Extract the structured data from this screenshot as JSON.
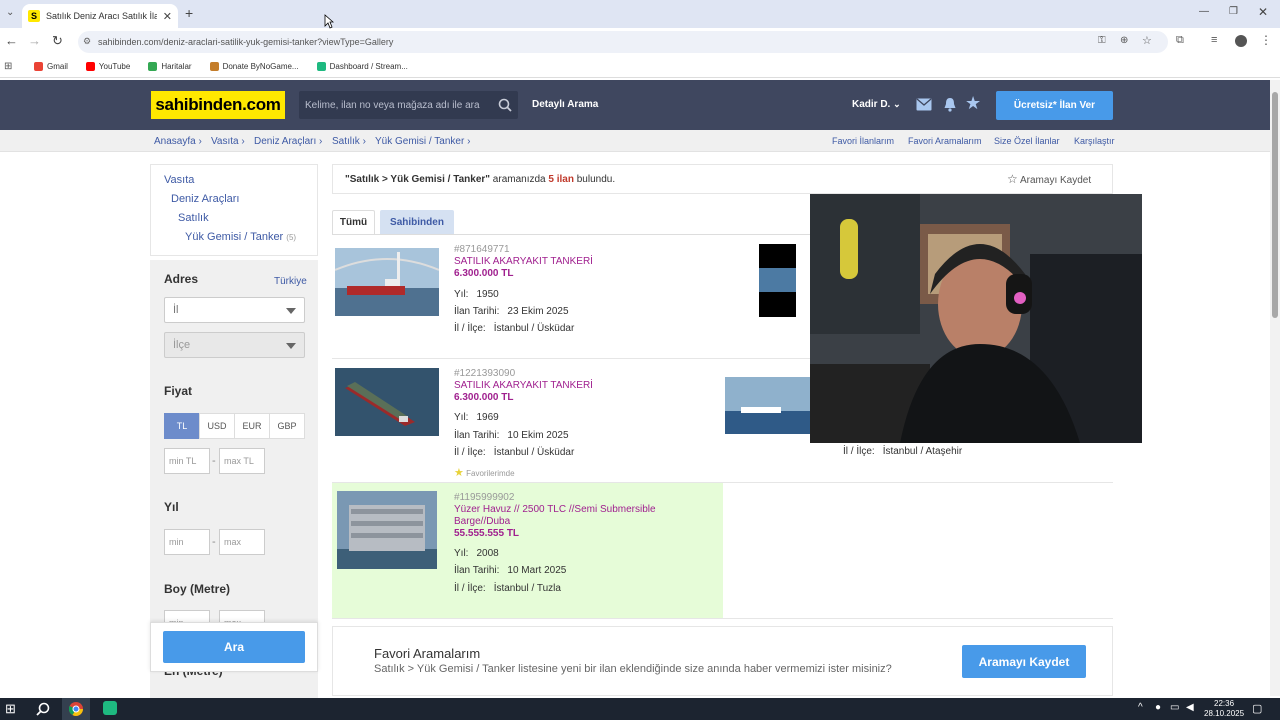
{
  "browser": {
    "tab_title": "Satılık Deniz Aracı Satılık İlanları",
    "tab_favicon": "S",
    "url": "sahibinden.com/deniz-araclari-satilik-yuk-gemisi-tanker?viewType=Gallery",
    "bookmarks": [
      {
        "label": "Gmail",
        "color": "#ea4335"
      },
      {
        "label": "YouTube",
        "color": "#ff0000"
      },
      {
        "label": "Haritalar",
        "color": "#34a853"
      },
      {
        "label": "Donate ByNoGame...",
        "color": "#c47d2a"
      },
      {
        "label": "Dashboard / Stream...",
        "color": "#1eb980"
      }
    ]
  },
  "header": {
    "logo": "sahibinden.com",
    "search_placeholder": "Kelime, ilan no veya mağaza adı ile ara",
    "detailed_search": "Detaylı Arama",
    "user_name": "Kadir D.",
    "post_ad_button": "Ücretsiz* İlan Ver"
  },
  "breadcrumb": [
    "Anasayfa",
    "Vasıta",
    "Deniz Araçları",
    "Satılık",
    "Yük Gemisi / Tanker"
  ],
  "top_links": [
    "Favori İlanlarım",
    "Favori Aramalarım",
    "Size Özel İlanlar",
    "Karşılaştır"
  ],
  "sidebar": {
    "categories": [
      "Vasıta",
      "Deniz Araçları",
      "Satılık",
      "Yük Gemisi / Tanker"
    ],
    "category_count": "(5)",
    "address_label": "Adres",
    "country_link": "Türkiye",
    "il_placeholder": "İl",
    "ilce_placeholder": "İlçe",
    "price_label": "Fiyat",
    "currencies": [
      "TL",
      "USD",
      "EUR",
      "GBP"
    ],
    "active_currency": "TL",
    "min_tl": "min TL",
    "max_tl": "max TL",
    "year_label": "Yıl",
    "min": "min",
    "max": "max",
    "length_label": "Boy (Metre)",
    "width_label": "En (Metre)",
    "search_button": "Ara"
  },
  "results": {
    "query": "\"Satılık > Yük Gemisi / Tanker\"",
    "query_suffix": "aramanızda",
    "count": "5 ilan",
    "found": "bulundu.",
    "save_search": "Aramayı Kaydet",
    "tabs": [
      "Tümü",
      "Sahibinden"
    ],
    "year_label": "Yıl:",
    "date_label": "İlan Tarihi:",
    "location_label": "İl / İlçe:",
    "favorites_note": "Favorilerimde",
    "listings": [
      {
        "id": "#871649771",
        "title": "SATILIK AKARYAKIT TANKERİ",
        "price": "6.300.000 TL",
        "year": "1950",
        "date": "23 Ekim 2025",
        "location": "İstanbul / Üsküdar"
      },
      {
        "id": "#1221393090",
        "title": "SATILIK AKARYAKIT TANKERİ",
        "price": "6.300.000 TL",
        "year": "1969",
        "date": "10 Ekim 2025",
        "location": "İstanbul / Üsküdar"
      },
      {
        "id": "#1195999902",
        "title": "Yüzer Havuz // 2500 TLC //Semi Submersible Barge//Duba",
        "price": "55.555.555 TL",
        "year": "2008",
        "date": "10 Mart 2025",
        "location": "İstanbul / Tuzla"
      }
    ],
    "right_location": "İstanbul / Ataşehir"
  },
  "favorites_box": {
    "title": "Favori Aramalarım",
    "text": "Satılık > Yük Gemisi / Tanker listesine yeni bir ilan eklendiğinde size anında haber vermemizi ister misiniz?",
    "button": "Aramayı Kaydet"
  },
  "taskbar": {
    "time": "22:36",
    "date": "28.10.2025"
  },
  "colors": {
    "brand_yellow": "#ffe800",
    "header_bg": "#3f475f",
    "link_blue": "#3e5aa5",
    "accent_blue": "#489ae9",
    "listing_purple": "#a0208f",
    "highlight_green": "#e6fcd8"
  }
}
